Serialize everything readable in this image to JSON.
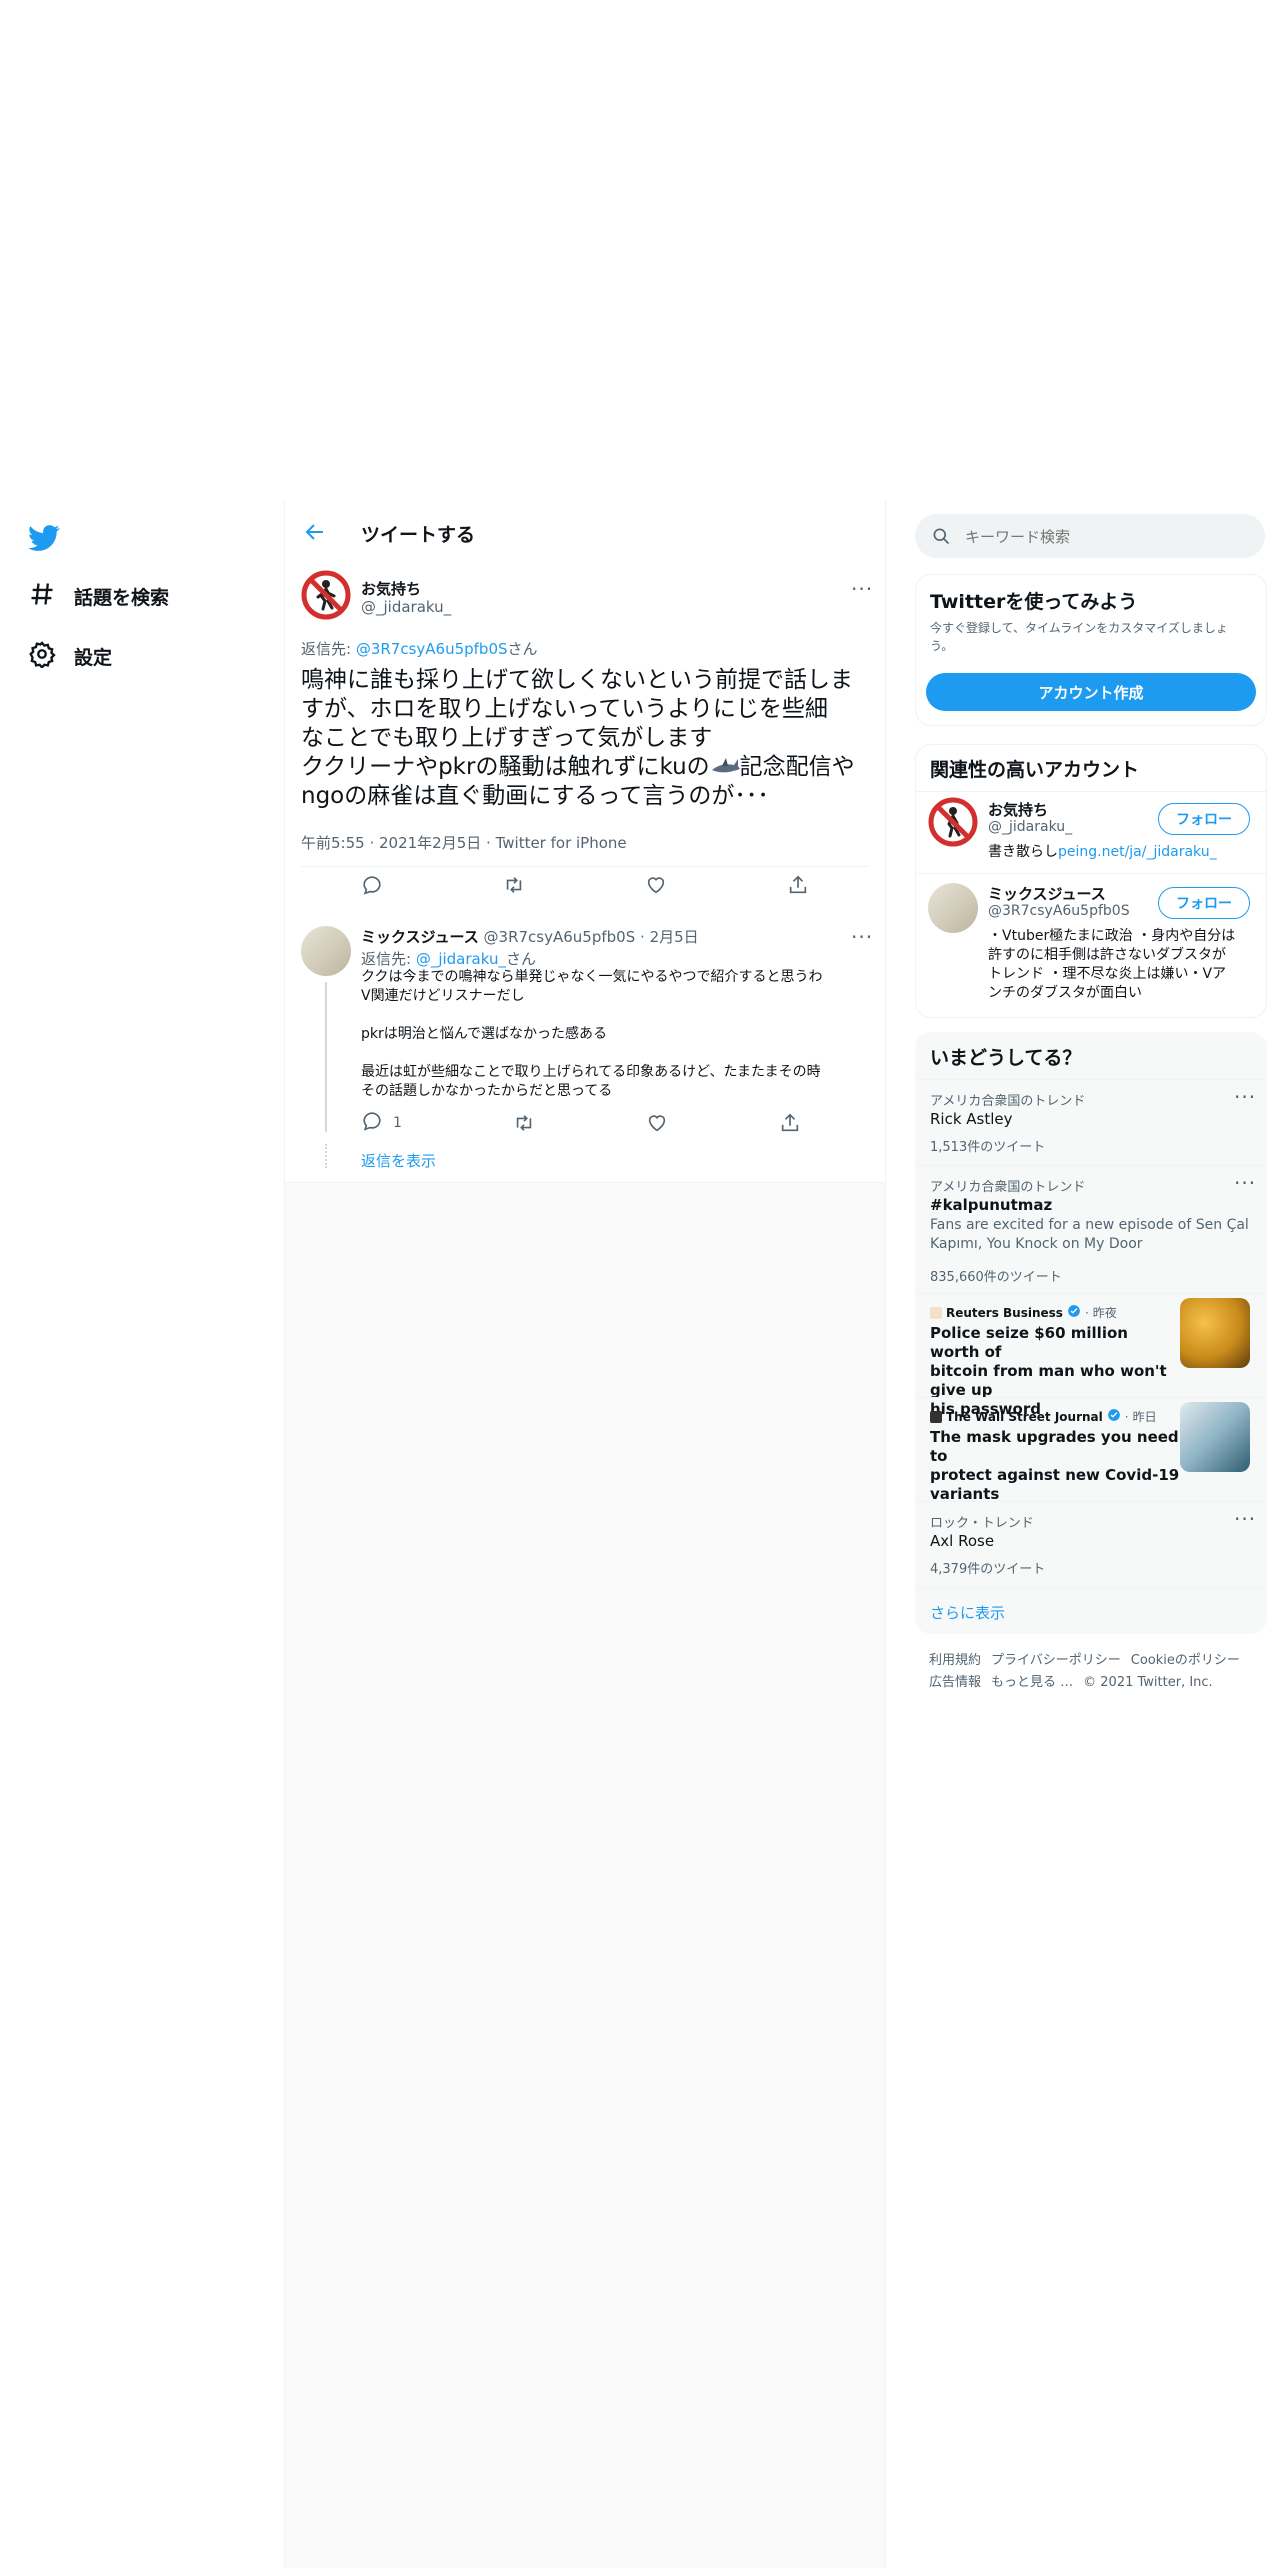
{
  "nav": {
    "items": [
      {
        "label": "話題を検索",
        "icon": "hashtag-icon"
      },
      {
        "label": "設定",
        "icon": "gear-icon"
      }
    ]
  },
  "header": {
    "title": "ツイートする"
  },
  "main_tweet": {
    "display_name": "お気持ち",
    "handle": "@_jidaraku_",
    "reply_prefix": "返信先: ",
    "reply_to": "@3R7csyA6u5pfb0S",
    "reply_suffix": "さん",
    "text_lines": [
      "鳴神に誰も採り上げて欲しくないという前提で話しま",
      "すが、ホロを取り上げないっていうよりにじを些細",
      "なことでも取り上げすぎって気がします",
      "ククリーナやpkrの騒動は触れずにkuの",
      "記念配信や",
      "ngoの麻雀は直ぐ動画にするって言うのが･･･"
    ],
    "time": "午前5:55",
    "date": "2021年2月5日",
    "source": "Twitter for iPhone"
  },
  "reply_tweet": {
    "display_name": "ミックスジュース",
    "handle": "@3R7csyA6u5pfb0S",
    "date": "2月5日",
    "reply_prefix": "返信先: ",
    "reply_to": "@_jidaraku_",
    "reply_suffix": "さん",
    "lines": [
      "ククは今までの鳴神なら単発じゃなく一気にやるやつで紹介すると思うわ",
      "V関連だけどリスナーだし",
      "pkrは明治と悩んで選ばなかった感ある",
      "最近は虹が些細なことで取り上げられてる印象あるけど、たまたまその時",
      "その話題しかなかったからだと思ってる"
    ],
    "reply_count": "1",
    "show_replies": "返信を表示"
  },
  "search": {
    "placeholder": "キーワード検索"
  },
  "signup": {
    "title": "Twitterを使ってみよう",
    "subtitle_line1": "今すぐ登録して、タイムラインをカスタマイズしましょ",
    "subtitle_line2": "う。",
    "button": "アカウント作成"
  },
  "related": {
    "title": "関連性の高いアカウント",
    "accounts": [
      {
        "display_name": "お気持ち",
        "handle": "@_jidaraku_",
        "bio_text": "書き散らし",
        "bio_link": "peing.net/ja/_jidaraku_",
        "follow": "フォロー"
      },
      {
        "display_name": "ミックスジュース",
        "handle": "@3R7csyA6u5pfb0S",
        "bio_lines": [
          "・Vtuber極たまに政治 ・身内や自分は",
          "許すのに相手側は許さないダブスタが",
          "トレンド ・理不尽な炎上は嫌い・Vア",
          "ンチのダブスタが面白い"
        ],
        "follow": "フォロー"
      }
    ]
  },
  "trends": {
    "title": "いまどうしてる？",
    "items": [
      {
        "meta": "アメリカ合衆国のトレンド",
        "title": "Rick Astley",
        "count": "1,513件のツイート"
      },
      {
        "meta": "アメリカ合衆国のトレンド",
        "title": "#kalpunutmaz",
        "desc_line1": "Fans are excited for a new episode of Sen Çal",
        "desc_line2": "Kapımı, You Knock on My Door",
        "count": "835,660件のツイート"
      },
      {
        "source": "Reuters Business",
        "time": "昨夜",
        "title_lines": [
          "Police seize $60 million worth of",
          "bitcoin from man who won't give up",
          "his password"
        ]
      },
      {
        "source": "The Wall Street Journal",
        "time": "昨日",
        "title_lines": [
          "The mask upgrades you need to",
          "protect against new Covid-19",
          "variants"
        ]
      },
      {
        "meta": "ロック・トレンド",
        "title": "Axl Rose",
        "count": "4,379件のツイート"
      }
    ],
    "show_more": "さらに表示"
  },
  "footer": {
    "links_row1": [
      "利用規約",
      "プライバシーポリシー",
      "Cookieのポリシー"
    ],
    "links_row2": [
      "広告情報",
      "もっと見る …"
    ],
    "copyright": "© 2021 Twitter, Inc."
  },
  "colors": {
    "accent": "#1d9bf0",
    "text": "#0f1419",
    "muted": "#536471"
  }
}
